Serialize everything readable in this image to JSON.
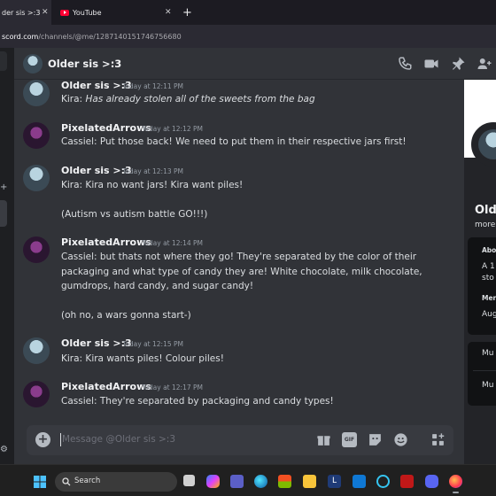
{
  "browser": {
    "tabs": [
      {
        "label": "der sis >:3",
        "active": true
      },
      {
        "label": "YouTube",
        "active": false
      }
    ],
    "new_tab": "+",
    "url_host": "scord.com",
    "url_path": "/channels/@me/1287140151746756680"
  },
  "channel": {
    "title": "Older sis >:3",
    "header_icons": [
      "phone-call-icon",
      "video-call-icon",
      "pin-icon",
      "add-friend-icon"
    ]
  },
  "messages": [
    {
      "author": "Older sis >:3",
      "time": "Today at 12:11 PM",
      "lines": [
        "Kira: ",
        "Has already stolen all of the sweets from the bag"
      ],
      "avatar": "older"
    },
    {
      "author": "PixelatedArrows",
      "time": "Today at 12:12 PM",
      "lines": [
        "Cassiel: Put those back! We need to put them in their respective jars first!"
      ],
      "avatar": "pix"
    },
    {
      "author": "Older sis >:3",
      "time": "Today at 12:13 PM",
      "lines": [
        "Kira: Kira no want jars! Kira want piles!",
        "(Autism vs autism battle GO!!!)"
      ],
      "avatar": "older"
    },
    {
      "author": "PixelatedArrows",
      "time": "Today at 12:14 PM",
      "lines": [
        "Cassiel: but thats not where they go! They're separated by the color of their",
        "packaging and what type of candy they are! White chocolate, milk chocolate,",
        "gumdrops, hard candy, and sugar candy!",
        "(oh no, a wars gonna start-)"
      ],
      "avatar": "pix"
    },
    {
      "author": "Older sis >:3",
      "time": "Today at 12:15 PM",
      "lines": [
        "Kira: Kira wants piles! Colour piles!"
      ],
      "avatar": "older"
    },
    {
      "author": "PixelatedArrows",
      "time": "Today at 12:17 PM",
      "lines": [
        "Cassiel: They're separated by packaging and candy types!"
      ],
      "avatar": "pix"
    }
  ],
  "composer": {
    "placeholder": "Message @Older sis >:3",
    "icons": [
      "add-attachment-icon",
      "gift-icon",
      "gif-icon",
      "sticker-icon",
      "emoji-icon",
      "apps-icon"
    ],
    "gif_label": "GIF"
  },
  "profile_panel": {
    "name": "Old",
    "sub": "more",
    "about_label": "Abo",
    "about_text_1": "A 1",
    "about_text_2": "sto",
    "member_label": "Mer",
    "member_text": "Aug",
    "row1": "Mu",
    "row2": "Mu"
  },
  "taskbar": {
    "search_label": "Search",
    "apps": [
      "windows-start-icon",
      "task-view-icon",
      "copilot-icon",
      "teams-icon",
      "edge-icon",
      "store-icon",
      "file-explorer-icon",
      "libreoffice-icon",
      "mail-icon",
      "cortana-icon",
      "mcafee-icon",
      "discord-icon",
      "game-icon",
      "firefox-icon"
    ]
  },
  "colors": {
    "chat_bg": "#313338",
    "composer_bg": "#383a40",
    "accent_blurple": "#5865f2"
  }
}
